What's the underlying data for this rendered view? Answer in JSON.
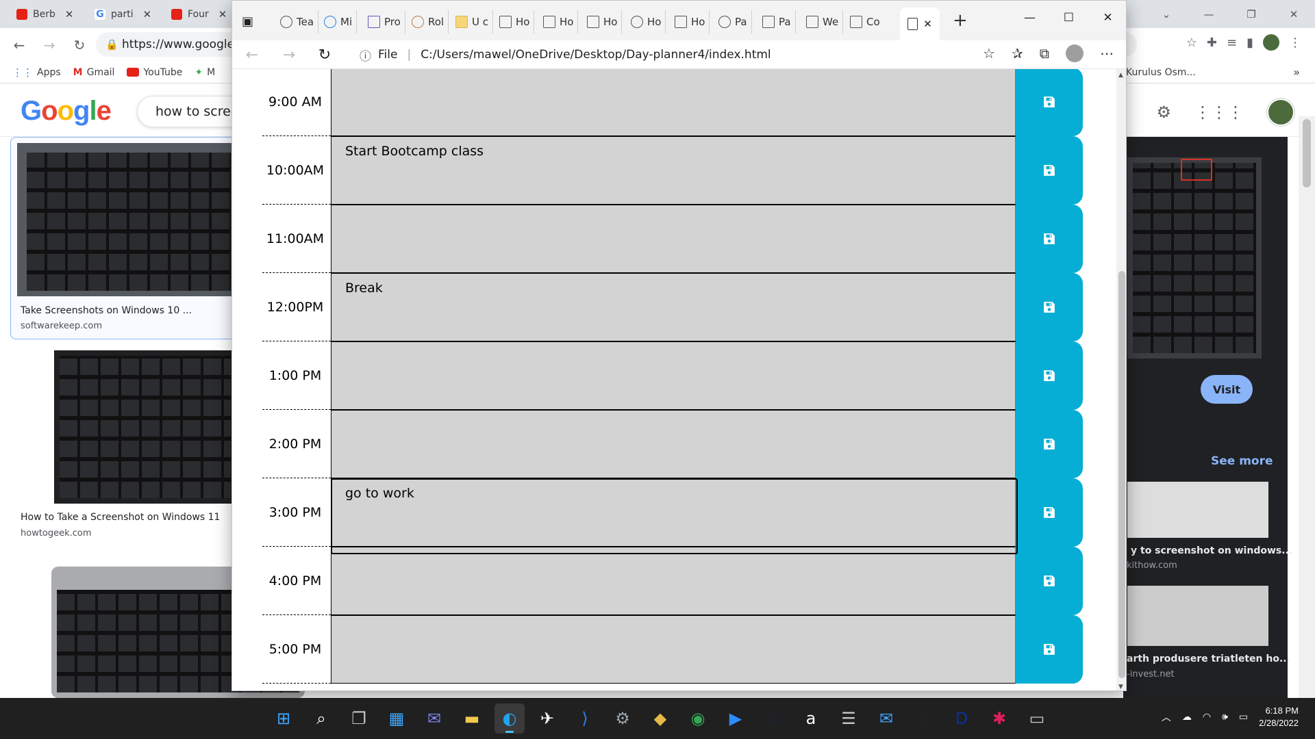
{
  "chrome": {
    "tabs": [
      "Berb",
      "parti",
      "Four"
    ],
    "url": "https://www.google.c",
    "bookmarks": [
      "Apps",
      "Gmail",
      "YouTube",
      "M"
    ],
    "extra_bookmark": "Kurulus Osm...",
    "search_query": "how to scree",
    "logo": "Google",
    "results": [
      {
        "title": "Take Screenshots on Windows 10 ...",
        "source": "softwarekeep.com"
      },
      {
        "title": "How to Take a Screenshot on Windows 11",
        "source": "howtogeek.com"
      }
    ],
    "right_panel": {
      "visit_label": "Visit",
      "see_more_label": "See more",
      "related": [
        {
          "title": "y to screenshot on windows...",
          "source": "kithow.com"
        },
        {
          "title": "arth produsere triatleten ho...",
          "source": "-invest.net"
        }
      ]
    }
  },
  "edge": {
    "tabs": [
      "Tea",
      "Mi",
      "Pro",
      "Rol",
      "U c",
      "Ho",
      "Ho",
      "Ho",
      "Ho",
      "Ho",
      "Pa",
      "Pa",
      "We",
      "Co"
    ],
    "address_label": "File",
    "address_path": "C:/Users/mawel/OneDrive/Desktop/Day-planner4/index.html"
  },
  "planner": {
    "rows": [
      {
        "hour": "9:00 AM",
        "text": ""
      },
      {
        "hour": "10:00AM",
        "text": "Start Bootcamp class"
      },
      {
        "hour": "11:00AM",
        "text": ""
      },
      {
        "hour": "12:00PM",
        "text": "Break"
      },
      {
        "hour": "1:00 PM",
        "text": ""
      },
      {
        "hour": "2:00 PM",
        "text": ""
      },
      {
        "hour": "3:00 PM",
        "text": "go to work"
      },
      {
        "hour": "4:00 PM",
        "text": ""
      },
      {
        "hour": "5:00 PM",
        "text": ""
      }
    ],
    "colors": {
      "past": "#d3d3d3",
      "save_button": "#06aed5"
    }
  },
  "taskbar": {
    "time": "6:18 PM",
    "date": "2/28/2022",
    "apps": [
      "start-icon",
      "search-icon",
      "task-view-icon",
      "widgets-icon",
      "teams-chat-icon",
      "file-explorer-icon",
      "edge-icon",
      "visual-studio-icon",
      "vscode-icon",
      "settings-icon",
      "git-icon",
      "chrome-icon",
      "zoom-icon",
      "steam-icon",
      "amazon-icon",
      "feedback-icon",
      "mail-icon",
      "steam-2-icon",
      "disney-plus-icon",
      "slack-icon",
      "terminal-icon"
    ]
  }
}
